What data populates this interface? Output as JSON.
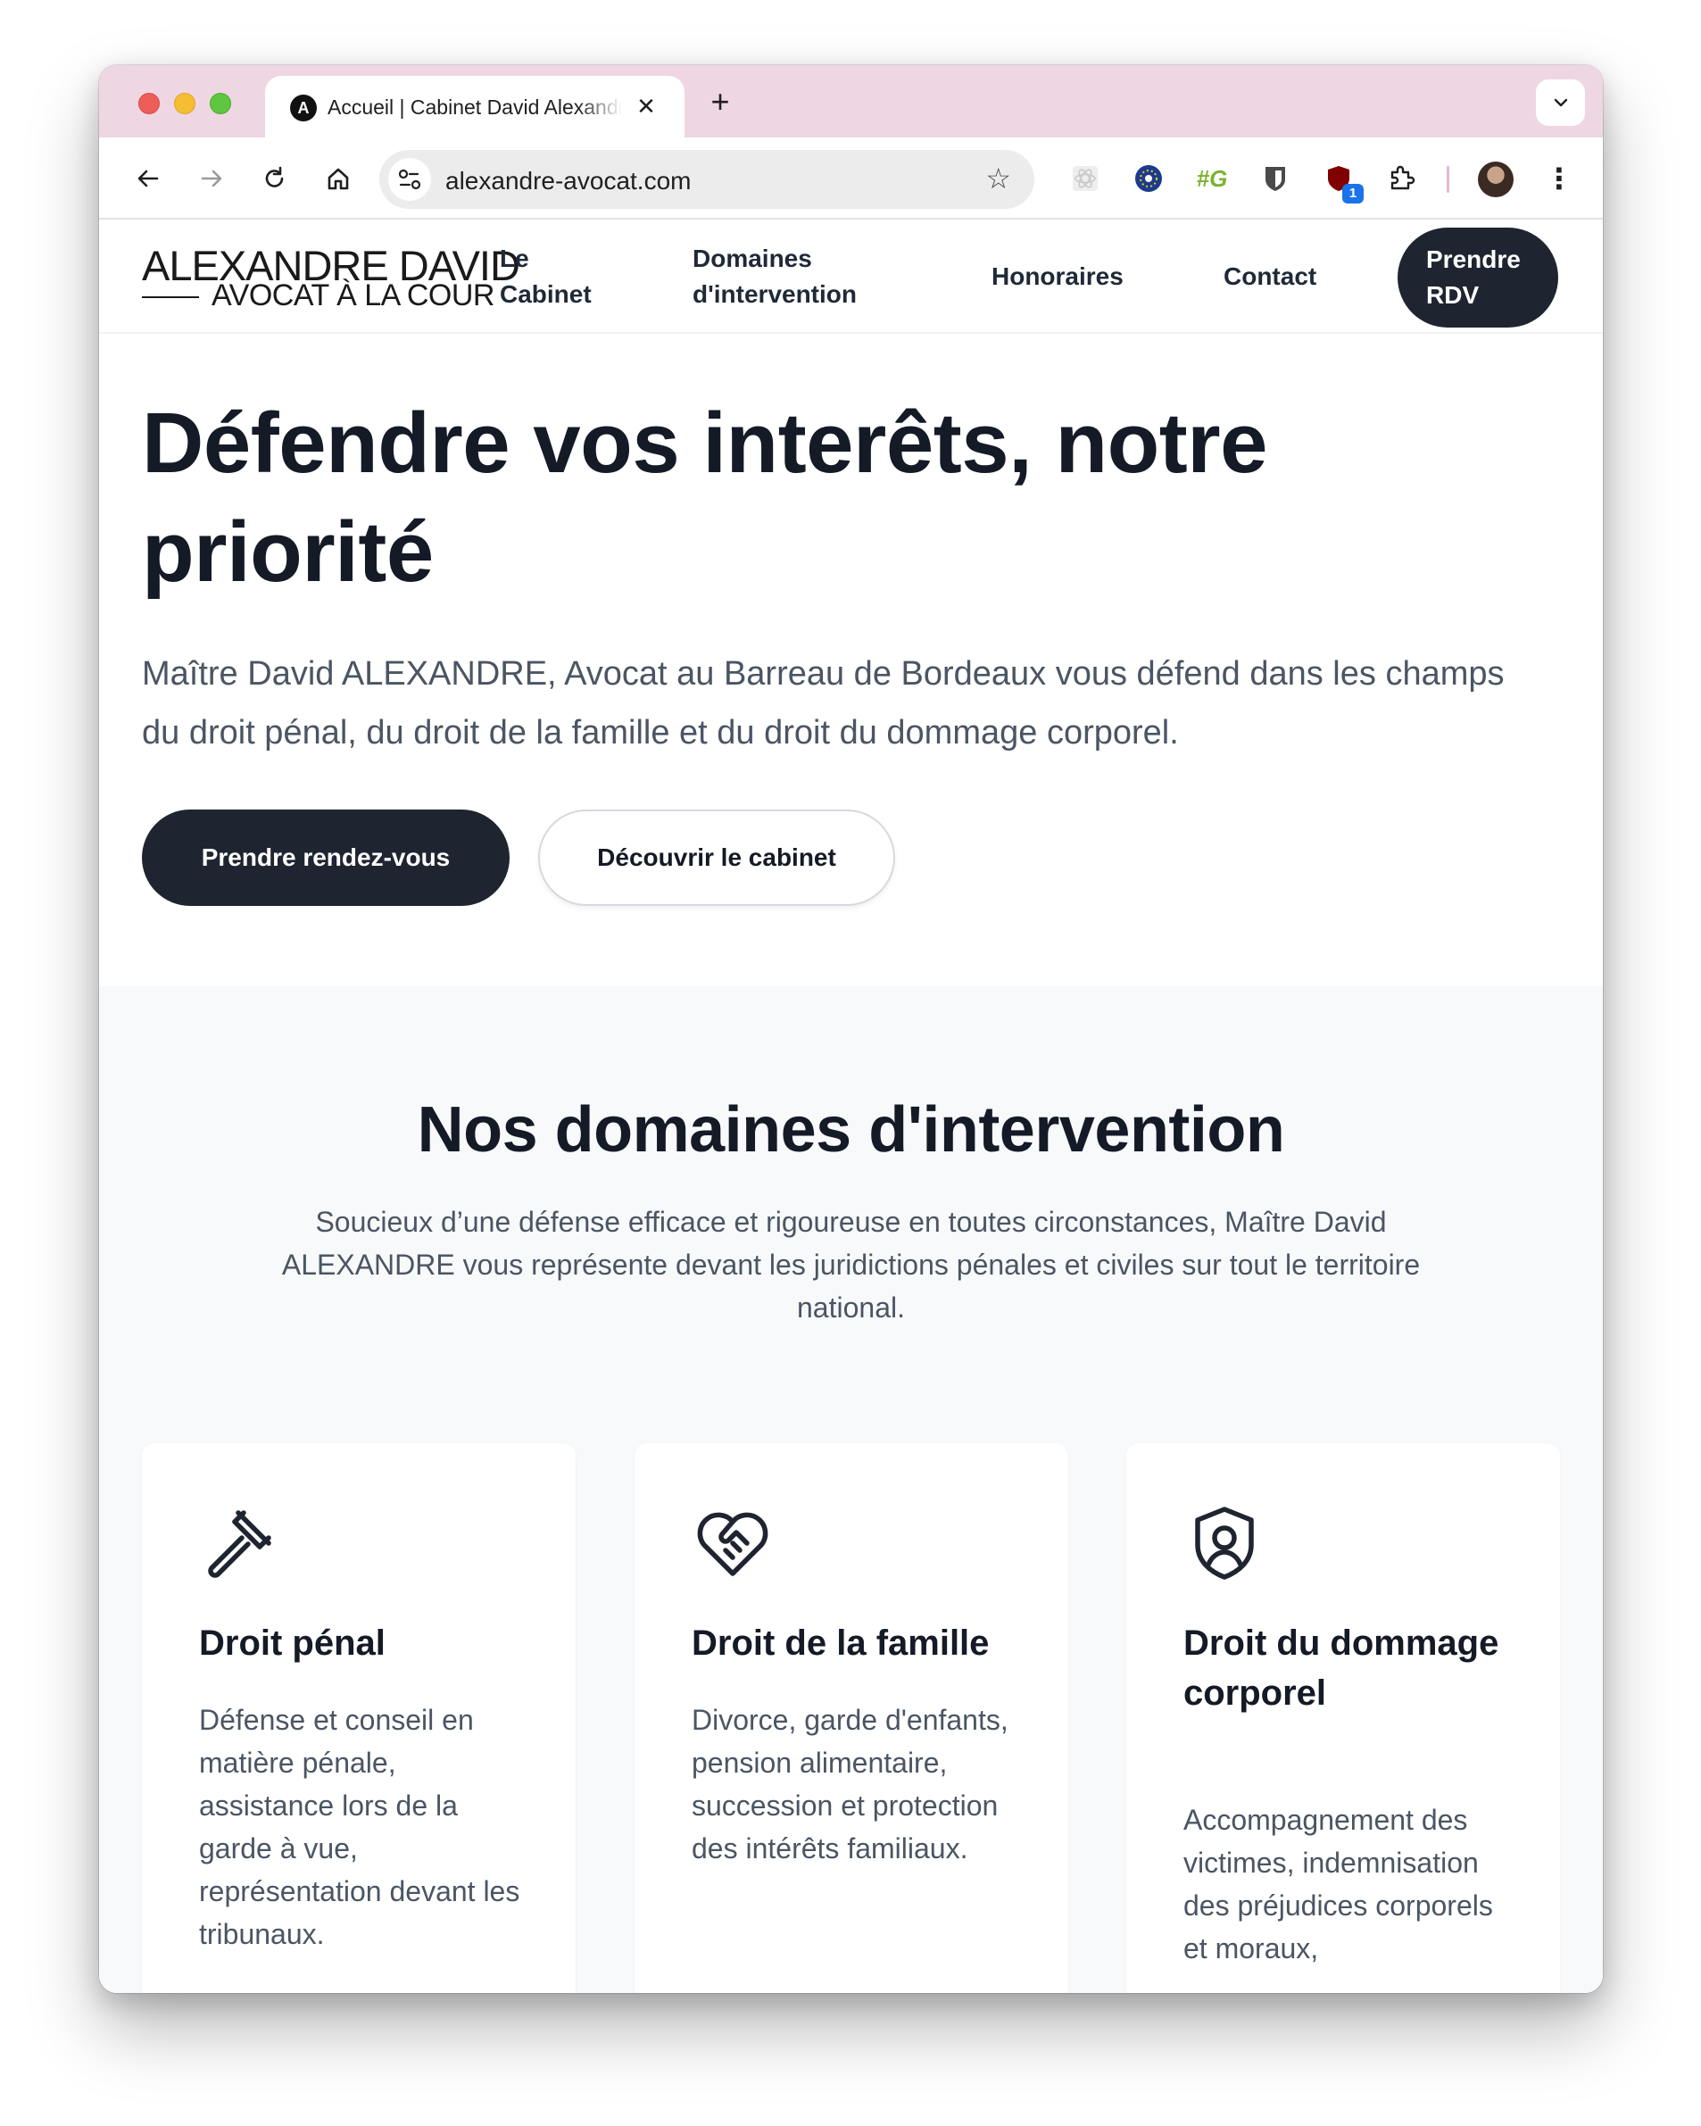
{
  "browser": {
    "tab_title": "Accueil | Cabinet David Alexandre",
    "tab_favicon_letter": "A",
    "url": "alexandre-avocat.com",
    "extension_badge": "1"
  },
  "site": {
    "logo_top": "ALEXANDRE DAVID",
    "logo_bottom": "AVOCAT À LA COUR",
    "nav": [
      "Le Cabinet",
      "Domaines d'intervention",
      "Honoraires",
      "Contact"
    ],
    "nav_cta": "Prendre RDV"
  },
  "hero": {
    "title": "Défendre vos interêts, notre priorité",
    "text": "Maître David ALEXANDRE, Avocat au Barreau de Bordeaux vous défend dans les champs du droit pénal, du droit de la famille et du droit du dommage corporel.",
    "primary_button": "Prendre rendez-vous",
    "secondary_button": "Découvrir le cabinet"
  },
  "domains": {
    "title": "Nos domaines d'intervention",
    "text": "Soucieux d’une défense efficace et rigoureuse en toutes circonstances, Maître David ALEXANDRE vous représente devant les juridictions pénales et civiles sur tout le territoire national.",
    "cards": [
      {
        "icon": "gavel-icon",
        "title": "Droit pénal",
        "text": "Défense et conseil en matière pénale, assistance lors de la garde à vue, représentation devant les tribunaux."
      },
      {
        "icon": "heart-handshake-icon",
        "title": "Droit de la famille",
        "text": "Divorce, garde d'enfants, pension alimentaire, succession et protection des intérêts familiaux."
      },
      {
        "icon": "shield-user-icon",
        "title": "Droit du dommage corporel",
        "text": "Accompagnement des victimes, indemnisation des préjudices corporels et moraux,"
      }
    ]
  }
}
